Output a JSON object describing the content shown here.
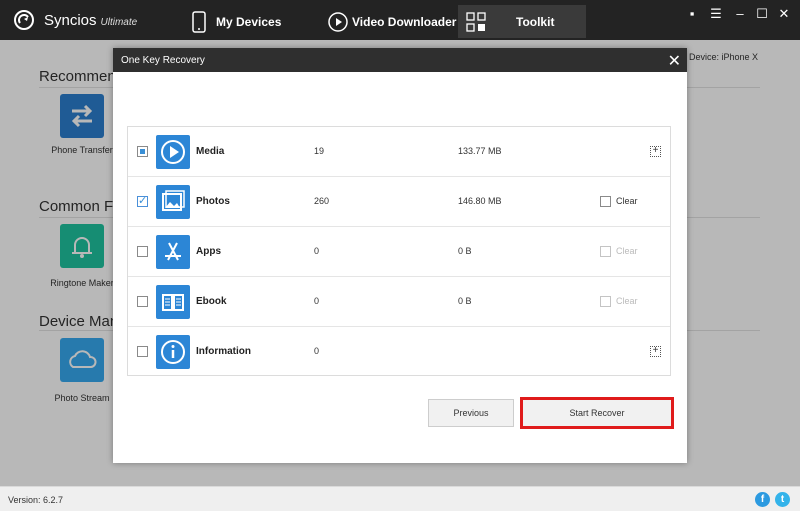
{
  "app": {
    "brand": "Syncios",
    "edition": "Ultimate"
  },
  "tabs": [
    {
      "label": "My Devices",
      "icon": "phone-icon"
    },
    {
      "label": "Video Downloader",
      "icon": "play-circle-icon"
    },
    {
      "label": "Toolkit",
      "icon": "grid-icon",
      "active": true
    }
  ],
  "window_controls": [
    "chat-icon",
    "menu-icon",
    "minimize-icon",
    "maximize-icon",
    "close-icon"
  ],
  "background": {
    "sections": [
      "Recommend",
      "Common Fu",
      "Device Man"
    ],
    "tiles": [
      {
        "label": "Phone Transfer",
        "icon": "transfer-arrows-icon",
        "color": "#2b7fcf"
      },
      {
        "label": "Ringtone Maker",
        "icon": "bell-icon",
        "color": "#1fc4a0"
      },
      {
        "label": "Photo Stream",
        "icon": "cloud-icon",
        "color": "#36aaf0"
      }
    ],
    "device_label": "ent Device: iPhone X"
  },
  "dialog": {
    "title": "One Key Recovery",
    "rows": [
      {
        "name": "Media",
        "count": "19",
        "size": "133.77 MB",
        "check": "partial",
        "icon": "media-play-icon",
        "trailing": "expand",
        "clear": ""
      },
      {
        "name": "Photos",
        "count": "260",
        "size": "146.80 MB",
        "check": "checked",
        "icon": "photos-icon",
        "trailing": "clear",
        "clear": "Clear"
      },
      {
        "name": "Apps",
        "count": "0",
        "size": "0 B",
        "check": "unchecked",
        "icon": "apps-icon",
        "trailing": "clear-disabled",
        "clear": "Clear"
      },
      {
        "name": "Ebook",
        "count": "0",
        "size": "0 B",
        "check": "unchecked",
        "icon": "ebook-icon",
        "trailing": "clear-disabled",
        "clear": "Clear"
      },
      {
        "name": "Information",
        "count": "0",
        "size": "",
        "check": "unchecked",
        "icon": "info-icon",
        "trailing": "expand",
        "clear": ""
      }
    ],
    "previous_label": "Previous",
    "start_label": "Start Recover"
  },
  "footer": {
    "version": "Version: 6.2.7"
  },
  "colors": {
    "accent": "#2c86d6",
    "highlight": "#e01b1b",
    "topbar": "#232323"
  }
}
